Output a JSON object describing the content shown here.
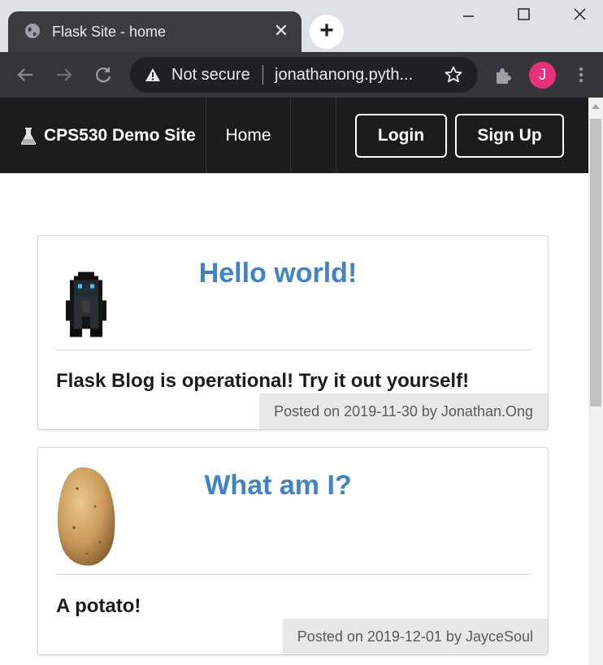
{
  "browser": {
    "tab_title": "Flask Site - home",
    "security_label": "Not secure",
    "url": "jonathanong.pyth...",
    "profile_initial": "J"
  },
  "site": {
    "brand": "CPS530 Demo Site",
    "nav": {
      "home": "Home"
    },
    "buttons": {
      "login": "Login",
      "signup": "Sign Up"
    }
  },
  "posts": [
    {
      "title": "Hello world!",
      "content": "Flask Blog is operational! Try it out yourself!",
      "meta": "Posted on 2019-11-30 by Jonathan.Ong",
      "image": "pixel-hooded-figure"
    },
    {
      "title": "What am I?",
      "content": "A potato!",
      "meta": "Posted on 2019-12-01 by JayceSoul",
      "image": "potato"
    }
  ],
  "colors": {
    "title_link": "#4183c4",
    "navbar": "#1b1c1d",
    "avatar": "#e8317a"
  }
}
